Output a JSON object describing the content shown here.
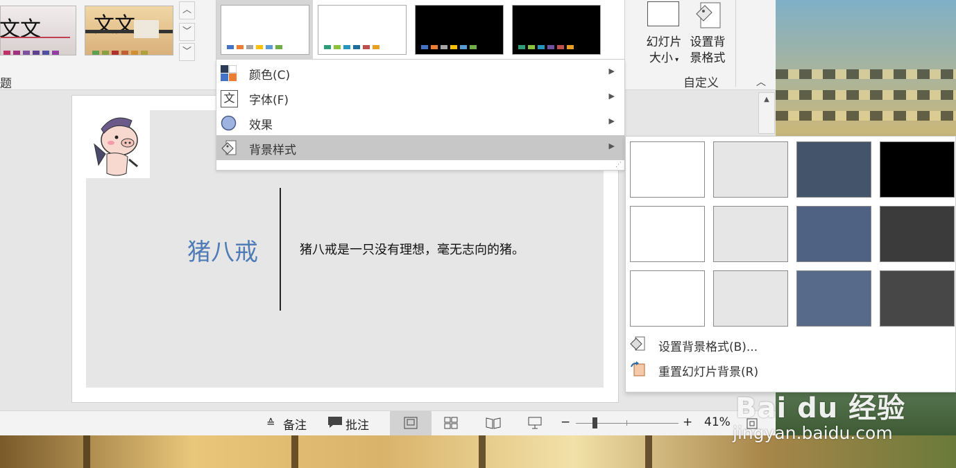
{
  "ribbon": {
    "theme_thumbs": [
      {
        "text": "文文"
      },
      {
        "text": "文文"
      }
    ],
    "group_left_label": "题",
    "slide_size_label_line1": "幻灯片",
    "slide_size_label_line2": "大小",
    "format_bg_label_line1": "设置背",
    "format_bg_label_line2": "景格式",
    "group_custom_label": "自定义"
  },
  "variant_menu": {
    "items": [
      {
        "label": "颜色(C)",
        "icon": "color-palette-icon"
      },
      {
        "label": "字体(F)",
        "icon": "font-icon"
      },
      {
        "label": "效果",
        "icon": "effects-icon"
      },
      {
        "label": "背景样式",
        "icon": "background-style-icon",
        "active": true
      }
    ]
  },
  "background_styles": {
    "swatches": [
      [
        "#ffffff",
        "#e7e6e6",
        "#44546a",
        "#000000"
      ],
      [
        "#ffffff",
        "#e7e6e6",
        "#4f6284",
        "#3b3b3b"
      ],
      [
        "#ffffff",
        "#e7e6e6",
        "#576a8a",
        "#474747"
      ]
    ],
    "format_background": "设置背景格式(B)...",
    "reset_background": "重置幻灯片背景(R)"
  },
  "slide": {
    "title": "猪八戒",
    "body": "猪八戒是一只没有理想，毫无志向的猪。"
  },
  "status_bar": {
    "notes": "备注",
    "comments": "批注",
    "zoom_minus": "−",
    "zoom_plus": "+",
    "zoom_level": "41%",
    "zoom_fraction": 0.41
  },
  "watermark": {
    "logo": "Bai du 经验",
    "url": "jingyan.baidu.com"
  }
}
